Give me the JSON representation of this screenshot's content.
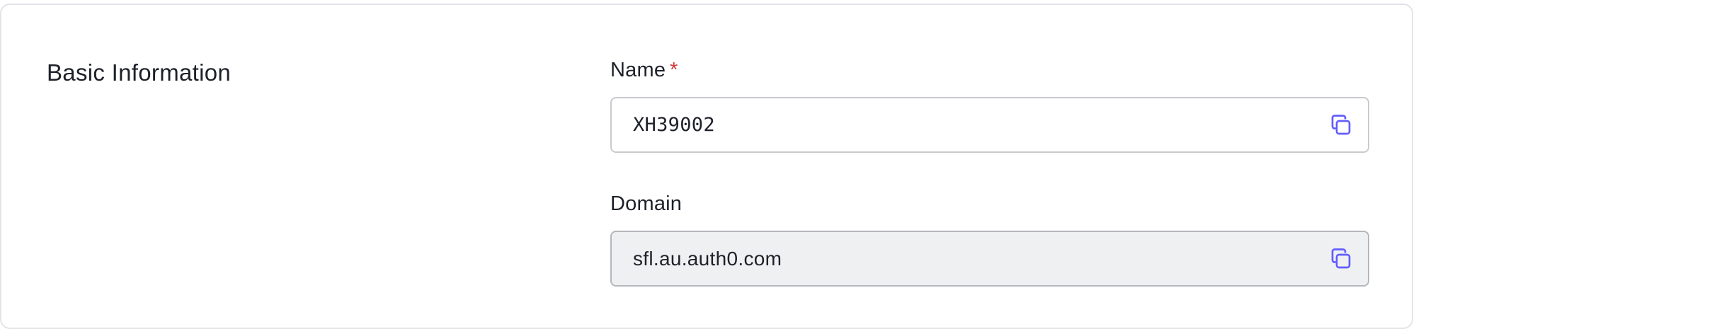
{
  "section": {
    "title": "Basic Information"
  },
  "fields": {
    "name": {
      "label": "Name",
      "required_marker": "*",
      "value": "XH39002",
      "copy_icon": "copy-icon"
    },
    "domain": {
      "label": "Domain",
      "value": "sfl.au.auth0.com",
      "copy_icon": "copy-icon",
      "readonly": true
    }
  },
  "colors": {
    "accent": "#635dff",
    "required": "#d03c38",
    "text": "#1e212a",
    "readonly_bg": "#eff0f2"
  }
}
